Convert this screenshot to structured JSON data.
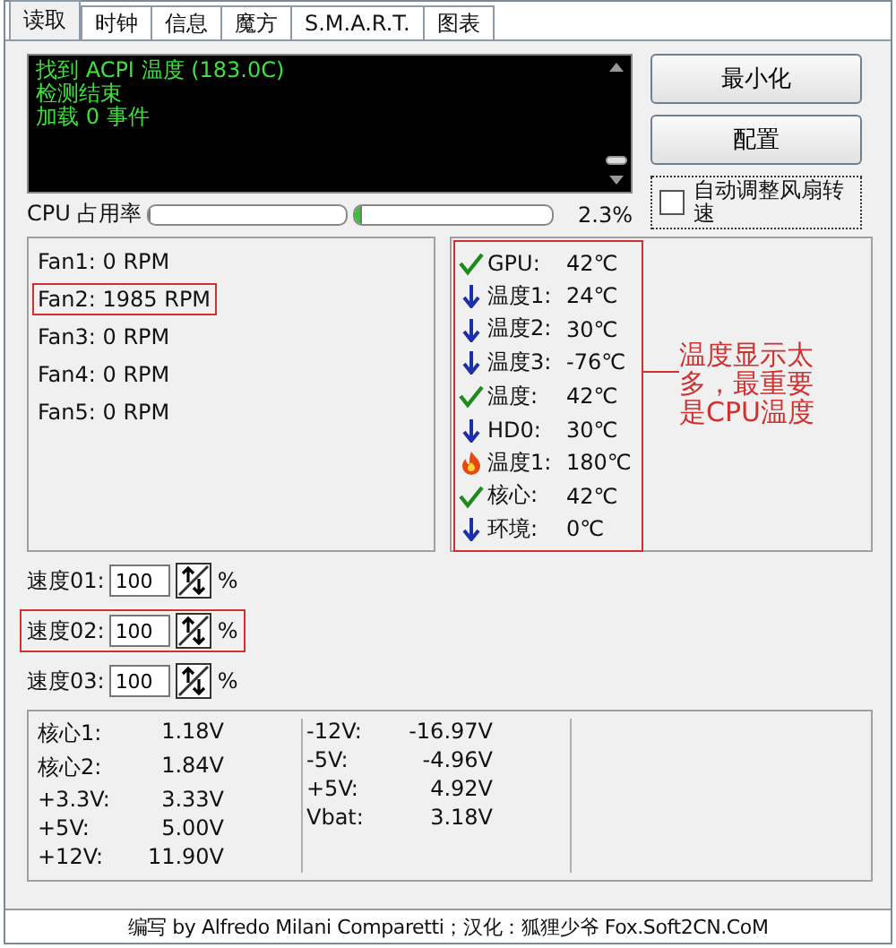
{
  "tabs": [
    {
      "label": "读取",
      "selected": true
    },
    {
      "label": "时钟",
      "selected": false
    },
    {
      "label": "信息",
      "selected": false
    },
    {
      "label": "魔方",
      "selected": false
    },
    {
      "label": "S.M.A.R.T.",
      "selected": false
    },
    {
      "label": "图表",
      "selected": false
    }
  ],
  "log": [
    "找到 ACPI 温度 (183.0C)",
    "检测结束",
    "加载 0 事件"
  ],
  "buttons": [
    "最小化",
    "配置"
  ],
  "auto_fan": {
    "label": "自动调整风扇转速",
    "checked": false
  },
  "cpu": {
    "label": "CPU 占用率",
    "bars": [
      {
        "level": 0
      },
      {
        "level": 0.023
      }
    ],
    "reading": "2.3%"
  },
  "fans": [
    {
      "text": "Fan1: 0 RPM",
      "highlighted": false
    },
    {
      "text": "Fan2: 1985 RPM",
      "highlighted": true
    },
    {
      "text": "Fan3: 0 RPM",
      "highlighted": false
    },
    {
      "text": "Fan4: 0 RPM",
      "highlighted": false
    },
    {
      "text": "Fan5: 0 RPM",
      "highlighted": false
    }
  ],
  "temps": {
    "highlighted": true,
    "items": [
      {
        "kind": "ok",
        "label": "GPU:",
        "value": "42℃"
      },
      {
        "kind": "low",
        "label": "温度1:",
        "value": "24℃"
      },
      {
        "kind": "low",
        "label": "温度2:",
        "value": "30℃"
      },
      {
        "kind": "low",
        "label": "温度3:",
        "value": "-76℃"
      },
      {
        "kind": "ok",
        "label": "温度:",
        "value": "42℃"
      },
      {
        "kind": "low",
        "label": "HD0:",
        "value": "30℃"
      },
      {
        "kind": "hot",
        "label": "温度1:",
        "value": "180℃"
      },
      {
        "kind": "ok",
        "label": "核心:",
        "value": "42℃"
      },
      {
        "kind": "low",
        "label": "环境:",
        "value": "0℃"
      }
    ]
  },
  "annotation": "温度显示太多，最重要是CPU温度",
  "speeds": [
    {
      "label": "速度01:",
      "value": "100",
      "unit": "%",
      "highlighted": false
    },
    {
      "label": "速度02:",
      "value": "100",
      "unit": "%",
      "highlighted": true
    },
    {
      "label": "速度03:",
      "value": "100",
      "unit": "%",
      "highlighted": false
    }
  ],
  "voltages": [
    [
      {
        "label": "核心1:",
        "value": "1.18V"
      },
      {
        "label": "核心2:",
        "value": "1.84V"
      },
      {
        "label": "+3.3V:",
        "value": "3.33V"
      },
      {
        "label": "+5V:",
        "value": "5.00V"
      },
      {
        "label": "+12V:",
        "value": "11.90V"
      }
    ],
    [
      {
        "label": "-12V:",
        "value": "-16.97V"
      },
      {
        "label": "-5V:",
        "value": "-4.96V"
      },
      {
        "label": "+5V:",
        "value": "4.92V"
      },
      {
        "label": "Vbat:",
        "value": "3.18V"
      }
    ]
  ],
  "status_bar": "编写 by Alfredo Milani Comparetti；汉化：狐狸少爷 Fox.Soft2CN.CoM"
}
